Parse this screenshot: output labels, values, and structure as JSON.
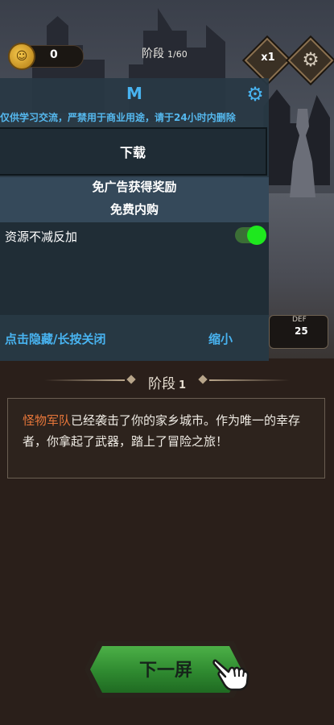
{
  "hud": {
    "coin_value": "0",
    "stage_label": "阶段",
    "stage_progress": "1/60",
    "speed_label": "x1",
    "def_label": "DEF",
    "def_value": "25"
  },
  "mod_menu": {
    "title": "M",
    "notice": "仅供学习交流，严禁用于商业用途，请于24小时内删除",
    "download_label": "下载",
    "feature_line1": "免广告获得奖励",
    "feature_line2": "免费内购",
    "option_label": "资源不减反加",
    "option_enabled": true,
    "hide_label": "点击隐藏/长按关闭",
    "shrink_label": "缩小"
  },
  "stage": {
    "heading": "阶段",
    "number": "1",
    "story_highlight": "怪物军队",
    "story_text": "已经袭击了你的家乡城市。作为唯一的幸存者，你拿起了武器，踏上了冒险之旅！"
  },
  "next_button": {
    "label": "下一屏"
  },
  "colors": {
    "accent_blue": "#48b3f0",
    "toggle_green": "#1ee81e",
    "story_highlight": "#e8773a",
    "button_green": "#3a9a3a"
  },
  "icons": {
    "coin": "coin-icon",
    "speed": "speed-toggle-icon",
    "settings": "gear-icon",
    "hand": "pointing-hand-icon"
  }
}
